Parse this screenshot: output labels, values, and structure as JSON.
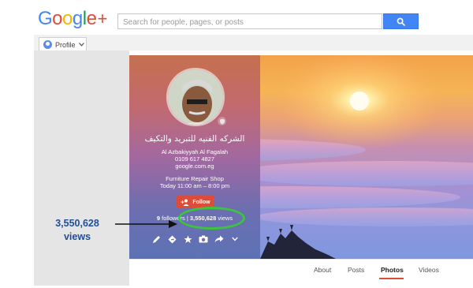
{
  "header": {
    "logo": {
      "google": "Google",
      "plus": "+",
      "colors": [
        "#4285f4",
        "#dd4b39",
        "#f4b400",
        "#4285f4",
        "#0f9d58",
        "#dd4b39"
      ]
    },
    "search": {
      "placeholder": "Search for people, pages, or posts"
    },
    "search_button_icon": "search-icon"
  },
  "profile_button": {
    "label": "Profile",
    "icon": "avatar-icon",
    "chevron": "chevron-down-icon"
  },
  "profile": {
    "name": "الشركه الفنيه للتبريد والتكيف",
    "address": "Al Azbakiyyah Al Fagalah",
    "phone": "0109 617 4827",
    "website": "google.com.eg",
    "category": "Furniture Repair Shop",
    "hours": "Today 11:00 am – 8:00 pm",
    "follow_label": "Follow",
    "followers_count": "9",
    "followers_word": "followers",
    "separator": "|",
    "views_count": "3,550,628",
    "views_word": "views",
    "action_icons": [
      "pencil-icon",
      "directions-icon",
      "star-icon",
      "camera-icon",
      "share-icon",
      "chevron-down-icon"
    ]
  },
  "annotation": {
    "count": "3,550,628",
    "word": "views",
    "color": "#1f4e9a",
    "highlight_color": "#3cc43c"
  },
  "tabs": [
    {
      "label": "About"
    },
    {
      "label": "Posts"
    },
    {
      "label": "Photos",
      "active": true
    },
    {
      "label": "Videos"
    }
  ],
  "accent_color": "#dd4b39"
}
